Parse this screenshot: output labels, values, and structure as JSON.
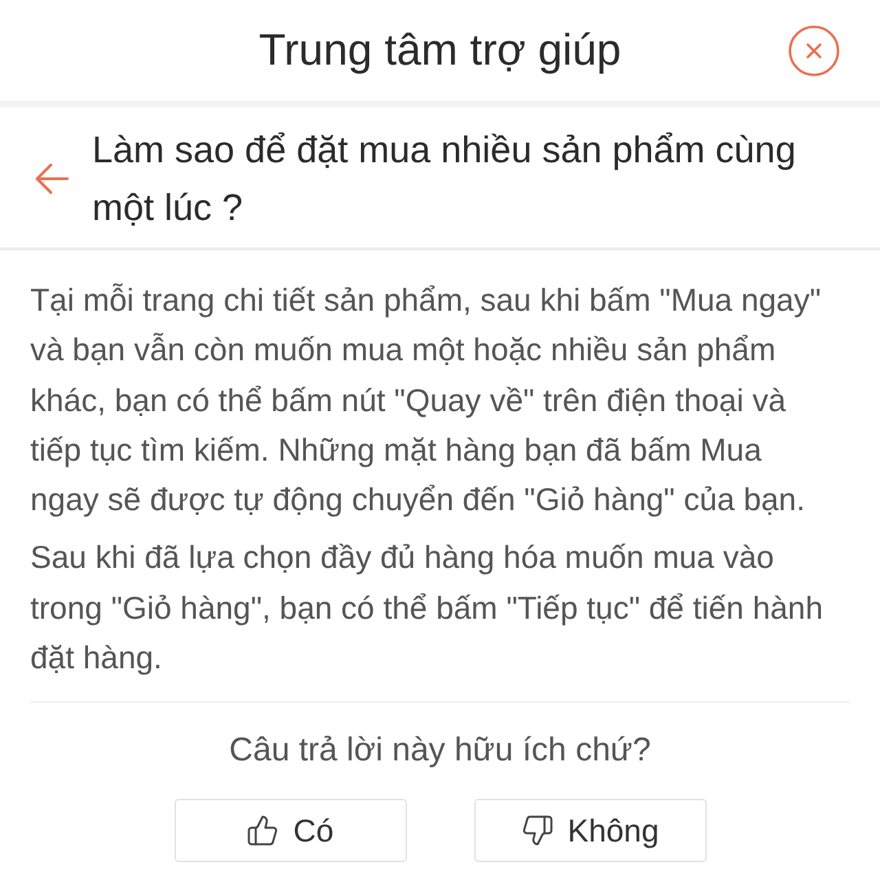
{
  "header": {
    "title": "Trung tâm trợ giúp"
  },
  "question": {
    "title": "Làm sao để đặt mua nhiều sản phẩm cùng một lúc ?"
  },
  "answer": {
    "paragraphs": [
      "Tại mỗi trang chi tiết sản phẩm, sau khi bấm \"Mua ngay\" và bạn vẫn còn muốn mua một hoặc nhiều sản phẩm khác, bạn có thể bấm nút \"Quay về\" trên điện thoại và tiếp tục tìm kiếm. Những mặt hàng bạn đã bấm Mua ngay sẽ được tự động chuyển đến \"Giỏ hàng\" của bạn.",
      "Sau khi đã lựa chọn đầy đủ hàng hóa muốn mua vào trong \"Giỏ hàng\", bạn có thể bấm \"Tiếp tục\" để tiến hành đặt hàng."
    ]
  },
  "feedback": {
    "prompt": "Câu trả lời này hữu ích chứ?",
    "buttons": [
      {
        "kind": "yes",
        "label": "Có"
      },
      {
        "kind": "no",
        "label": "Không"
      }
    ]
  }
}
